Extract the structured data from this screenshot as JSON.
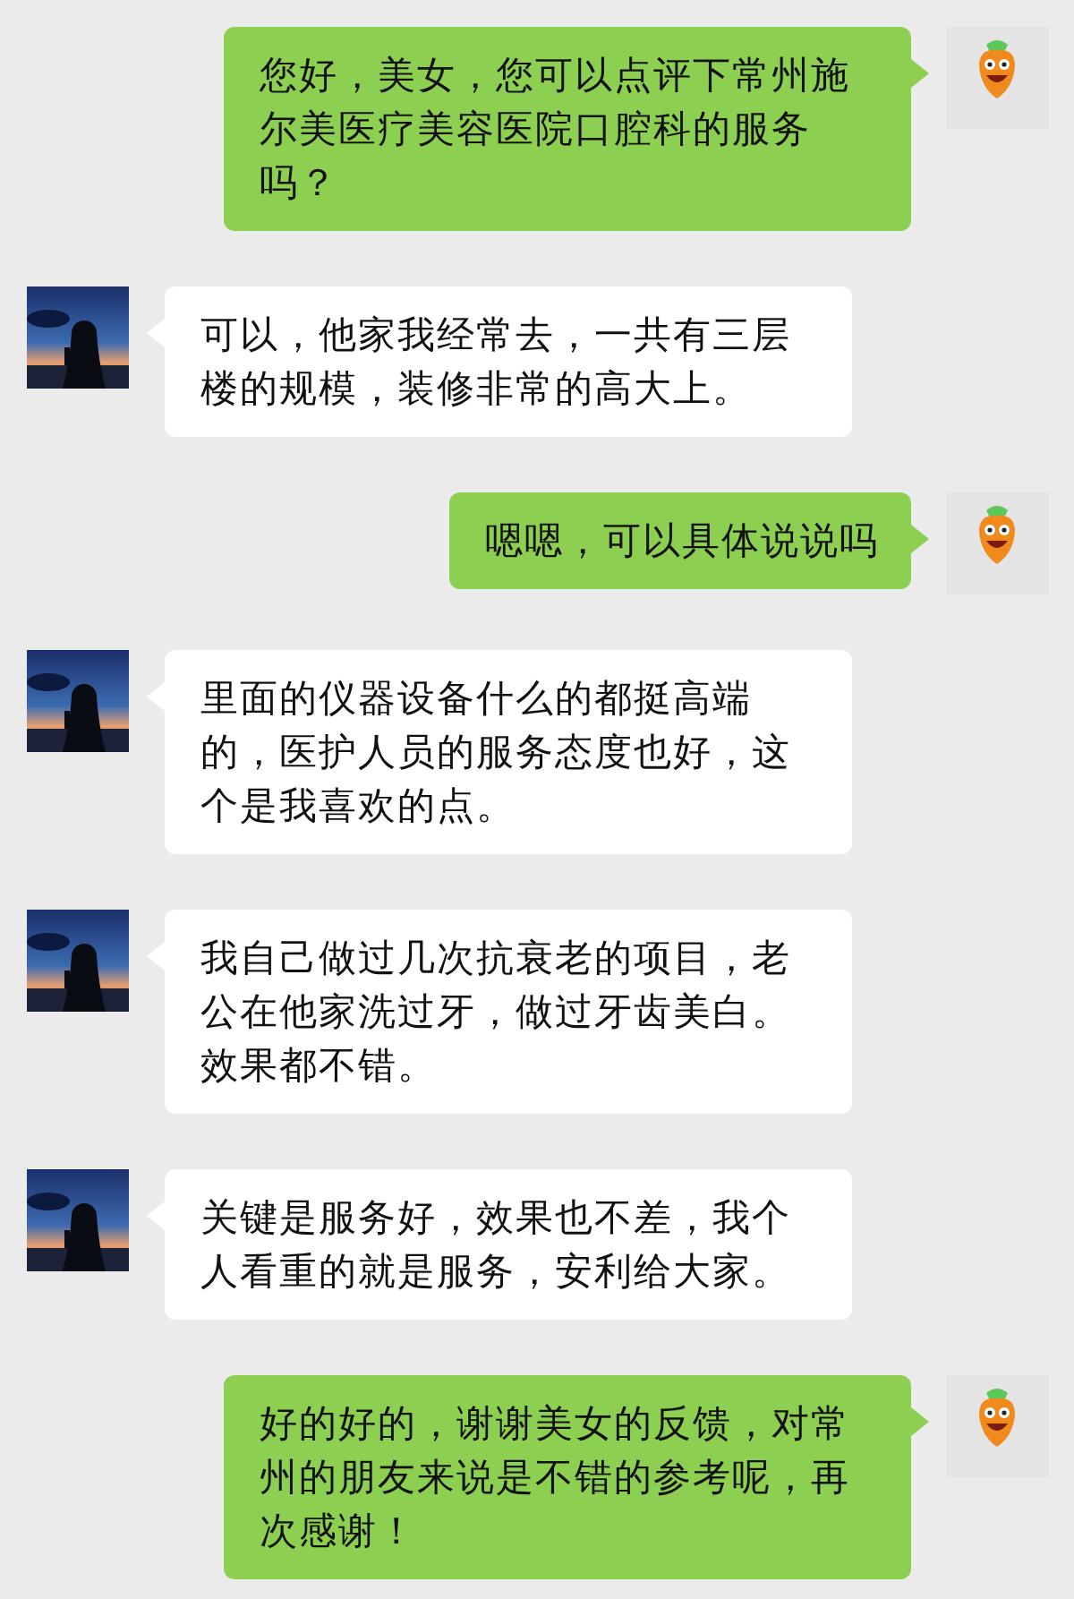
{
  "messages": [
    {
      "kind": "outgoing",
      "text": "您好，美女，您可以点评下常州施尔美医疗美容医院口腔科的服务吗？"
    },
    {
      "kind": "incoming",
      "text": "可以，他家我经常去，一共有三层楼的规模，装修非常的高大上。"
    },
    {
      "kind": "outgoing",
      "text": "嗯嗯，可以具体说说吗"
    },
    {
      "kind": "incoming",
      "text": "里面的仪器设备什么的都挺高端的，医护人员的服务态度也好，这个是我喜欢的点。"
    },
    {
      "kind": "incoming",
      "text": "我自己做过几次抗衰老的项目，老公在他家洗过牙，做过牙齿美白。效果都不错。"
    },
    {
      "kind": "incoming",
      "text": "关键是服务好，效果也不差，我个人看重的就是服务，安利给大家。"
    },
    {
      "kind": "outgoing",
      "text": "好的好的，谢谢美女的反馈，对常州的朋友来说是不错的参考呢，再次感谢！"
    }
  ]
}
